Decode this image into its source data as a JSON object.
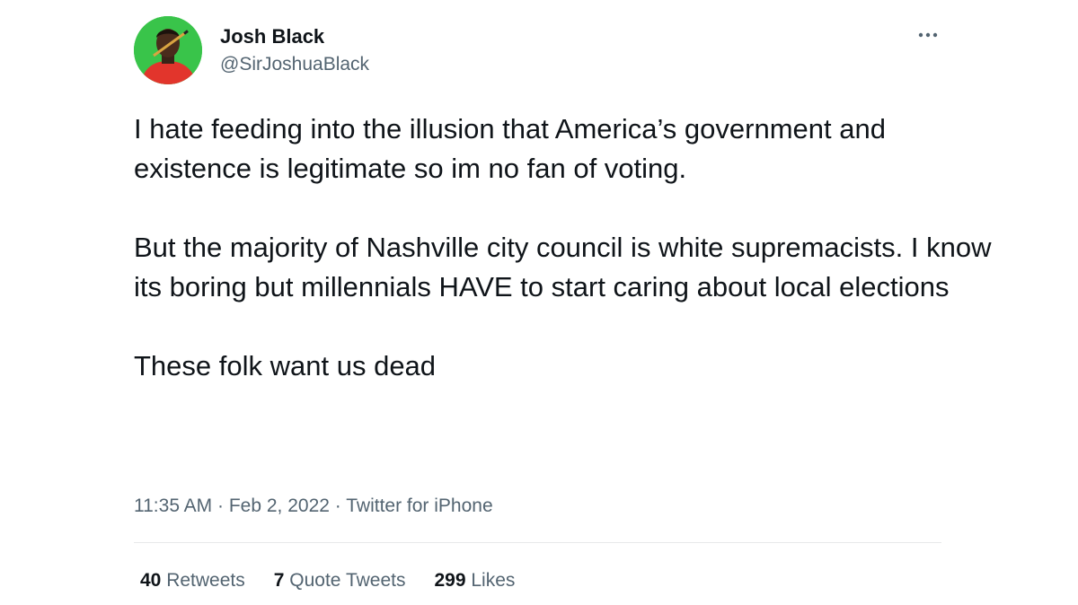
{
  "author": {
    "name": "Josh Black",
    "handle": "@SirJoshuaBlack"
  },
  "tweet": {
    "paragraphs": [
      "I hate feeding into the illusion that America’s government and existence is legitimate so im no fan of voting.",
      "But the majority of Nashville city council is white supremacists. I know its boring but millennials HAVE to start caring about local elections",
      "These folk want us dead"
    ]
  },
  "meta": {
    "time": "11:35 AM",
    "separator": " · ",
    "date": "Feb 2, 2022",
    "source": "Twitter for iPhone"
  },
  "stats": {
    "retweets_count": "40",
    "retweets_label": "Retweets",
    "quotes_count": "7",
    "quotes_label": "Quote Tweets",
    "likes_count": "299",
    "likes_label": "Likes"
  },
  "icons": {
    "more": "more-horizontal-icon"
  },
  "colors": {
    "text": "#0f1419",
    "secondary": "#536471",
    "divider": "#e7e9ea",
    "avatar_bg": "#39c44a"
  }
}
